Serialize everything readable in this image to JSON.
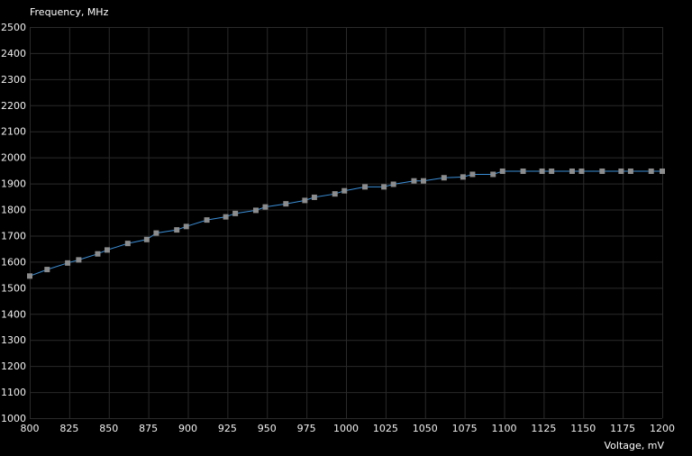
{
  "chart_data": {
    "type": "line",
    "title": "",
    "xlabel": "Voltage, mV",
    "ylabel": "Frequency, MHz",
    "xlim": [
      800,
      1200
    ],
    "ylim": [
      1000,
      2500
    ],
    "grid": true,
    "colors": {
      "background": "#000000",
      "grid": "#2a2a2a",
      "line": "#3a8fd8",
      "marker": "#8c8c8c",
      "text": "#f0f0f0"
    },
    "xticks": [
      800,
      825,
      850,
      875,
      900,
      925,
      950,
      975,
      1000,
      1025,
      1050,
      1075,
      1100,
      1125,
      1150,
      1175,
      1200
    ],
    "yticks": [
      1000,
      1100,
      1200,
      1300,
      1400,
      1500,
      1600,
      1700,
      1800,
      1900,
      2000,
      2100,
      2200,
      2300,
      2400,
      2500
    ],
    "x": [
      800,
      811,
      824,
      831,
      843,
      849,
      862,
      874,
      880,
      893,
      899,
      912,
      924,
      930,
      943,
      949,
      962,
      974,
      980,
      993,
      999,
      1012,
      1024,
      1030,
      1043,
      1049,
      1062,
      1074,
      1080,
      1093,
      1099,
      1112,
      1124,
      1130,
      1143,
      1149,
      1162,
      1174,
      1180,
      1193,
      1200
    ],
    "y": [
      1545,
      1570,
      1595,
      1607,
      1630,
      1645,
      1670,
      1685,
      1710,
      1722,
      1735,
      1760,
      1772,
      1785,
      1797,
      1810,
      1822,
      1835,
      1847,
      1860,
      1872,
      1887,
      1887,
      1897,
      1910,
      1910,
      1922,
      1925,
      1935,
      1935,
      1947,
      1947,
      1947,
      1947,
      1947,
      1947,
      1947,
      1947,
      1947,
      1947,
      1947
    ]
  }
}
